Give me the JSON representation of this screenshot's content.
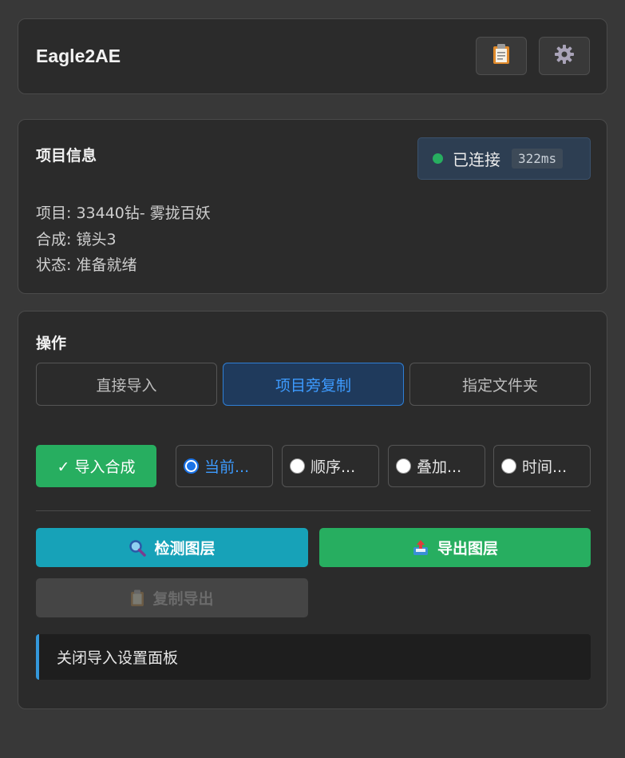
{
  "header": {
    "title": "Eagle2AE",
    "log_icon": "clipboard-icon",
    "settings_icon": "gear-icon"
  },
  "project": {
    "section_title": "项目信息",
    "connection": {
      "status": "已连接",
      "latency": "322ms",
      "status_color": "#27ae60"
    },
    "lines": [
      "项目: 33440钻- 雾拢百妖",
      "合成: 镜头3",
      "状态: 准备就绪"
    ]
  },
  "operations": {
    "section_title": "操作",
    "modes": [
      {
        "label": "直接导入",
        "active": false
      },
      {
        "label": "项目旁复制",
        "active": true
      },
      {
        "label": "指定文件夹",
        "active": false
      }
    ],
    "import_toggle": "✓ 导入合成",
    "radio_options": [
      {
        "label": "当前...",
        "checked": true
      },
      {
        "label": "顺序...",
        "checked": false
      },
      {
        "label": "叠加...",
        "checked": false
      },
      {
        "label": "时间...",
        "checked": false
      }
    ],
    "buttons": {
      "detect": "检测图层",
      "export": "导出图层",
      "copy_export": "复制导出"
    },
    "notice": "关闭导入设置面板"
  },
  "colors": {
    "accent_blue": "#3d9bff",
    "success_green": "#27ae60",
    "info_teal": "#17a2b8"
  }
}
